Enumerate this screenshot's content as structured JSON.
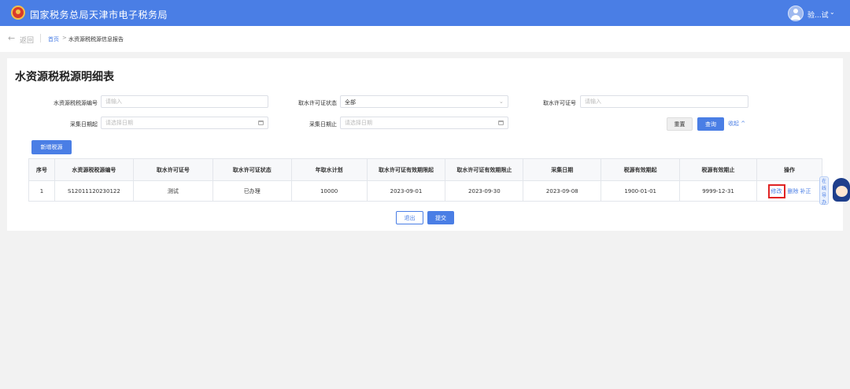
{
  "header": {
    "title": "国家税务总局天津市电子税务局",
    "user_name": "验...试",
    "brand_color": "#4a7ee5"
  },
  "breadcrumb": {
    "back": "返回",
    "home": "首页",
    "separator": ">",
    "current": "水资源税税源信息报告"
  },
  "page": {
    "title": "水资源税税源明细表"
  },
  "filters": {
    "source_id_label": "水资源税税源编号",
    "source_id_placeholder": "请输入",
    "permit_status_label": "取水许可证状态",
    "permit_status_value": "全部",
    "permit_no_label": "取水许可证号",
    "permit_no_placeholder": "请输入",
    "date_start_label": "采集日期起",
    "date_start_placeholder": "请选择日期",
    "date_end_label": "采集日期止",
    "date_end_placeholder": "请选择日期",
    "reset_label": "重置",
    "query_label": "查询",
    "collapse_label": "收起"
  },
  "toolbar": {
    "add_label": "新增税源"
  },
  "table": {
    "headers": [
      "序号",
      "水资源税税源编号",
      "取水许可证号",
      "取水许可证状态",
      "年取水计划",
      "取水许可证有效期限起",
      "取水许可证有效期限止",
      "采集日期",
      "税源有效期起",
      "税源有效期止",
      "操作"
    ],
    "rows": [
      {
        "index": "1",
        "source_id": "S12011120230122",
        "permit_no": "测试",
        "status": "已办理",
        "annual_plan": "10000",
        "permit_start": "2023-09-01",
        "permit_end": "2023-09-30",
        "collect_date": "2023-09-08",
        "valid_start": "1900-01-01",
        "valid_end": "9999-12-31",
        "op_edit": "修改",
        "op_delete": "删除",
        "op_correct": "补正"
      }
    ]
  },
  "footer": {
    "exit_label": "退出",
    "submit_label": "提交"
  },
  "assistant": {
    "tag": "在线导办"
  }
}
